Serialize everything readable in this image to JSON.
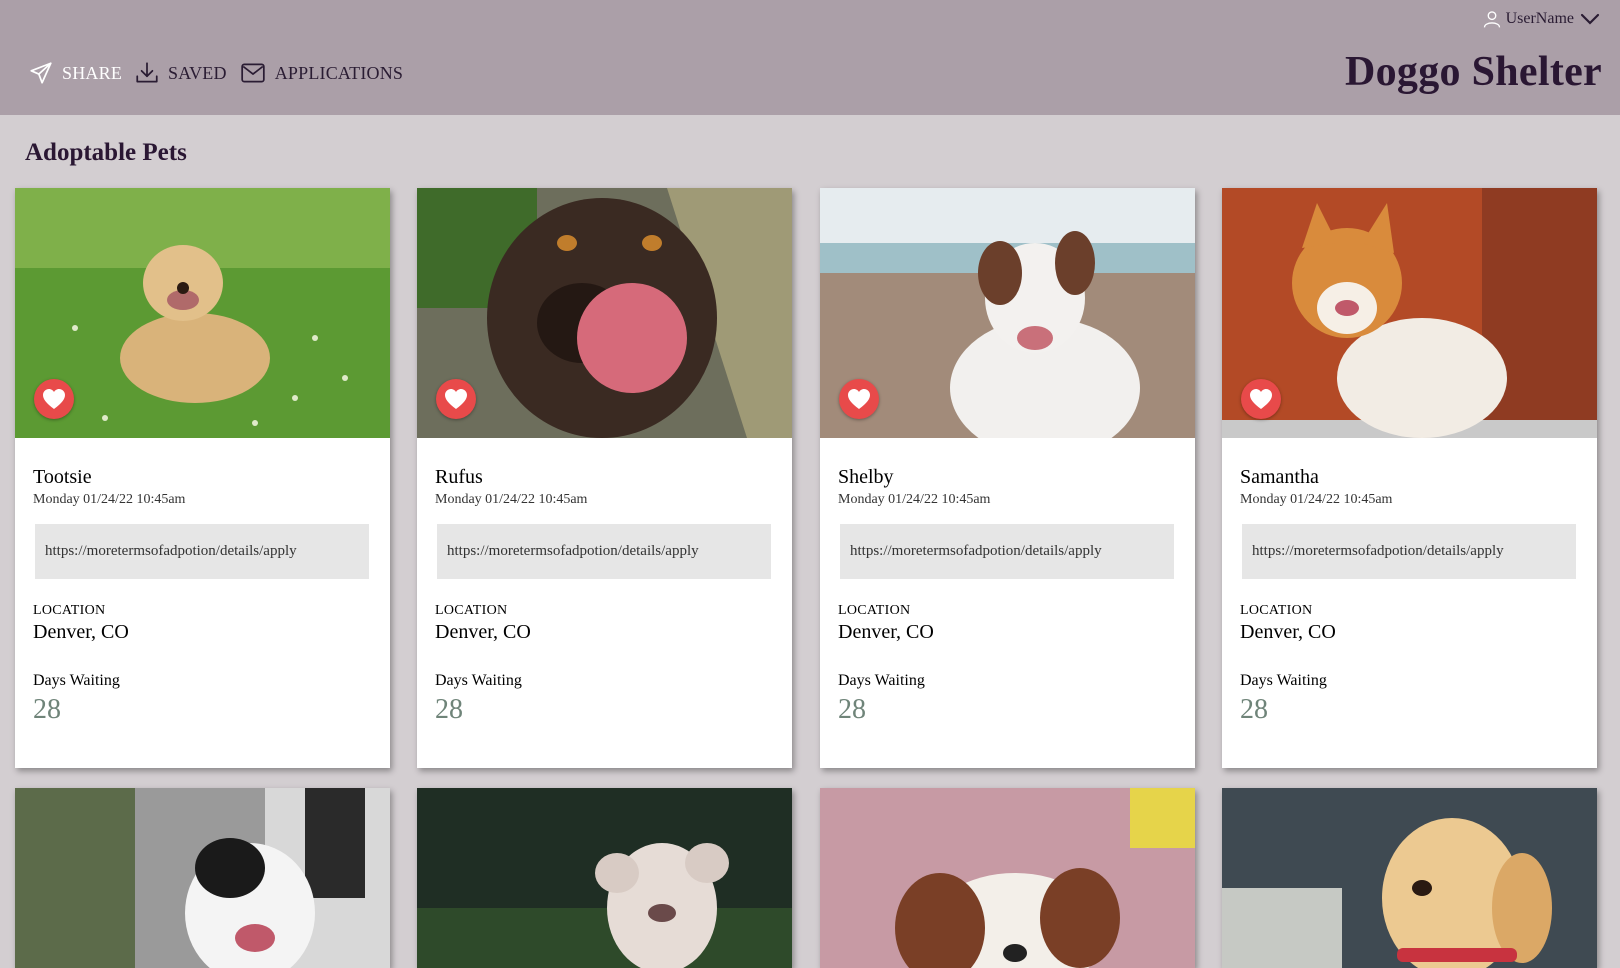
{
  "header": {
    "nav": [
      {
        "label": "SHARE",
        "icon": "send-icon"
      },
      {
        "label": "SAVED",
        "icon": "download-icon"
      },
      {
        "label": "APPLICATIONS",
        "icon": "mail-icon"
      }
    ],
    "user_label": "UserName",
    "brand": "Doggo Shelter"
  },
  "main": {
    "title": "Adoptable Pets",
    "cards": [
      {
        "name": "Tootsie",
        "date": "Monday 01/24/22 10:45am",
        "link": "https://moretermsofadpotion/details/apply",
        "location_label": "LOCATION",
        "location": "Denver, CO",
        "days_label": "Days Waiting",
        "days": "28"
      },
      {
        "name": "Rufus",
        "date": "Monday 01/24/22 10:45am",
        "link": "https://moretermsofadpotion/details/apply",
        "location_label": "LOCATION",
        "location": "Denver, CO",
        "days_label": "Days Waiting",
        "days": "28"
      },
      {
        "name": "Shelby",
        "date": "Monday 01/24/22 10:45am",
        "link": "https://moretermsofadpotion/details/apply",
        "location_label": "LOCATION",
        "location": "Denver, CO",
        "days_label": "Days Waiting",
        "days": "28"
      },
      {
        "name": "Samantha",
        "date": "Monday 01/24/22 10:45am",
        "link": "https://moretermsofadpotion/details/apply",
        "location_label": "LOCATION",
        "location": "Denver, CO",
        "days_label": "Days Waiting",
        "days": "28"
      }
    ]
  },
  "colors": {
    "header_bg": "#ab9fa8",
    "page_bg": "#d3ced1",
    "brand_text": "#2a1733",
    "favorite": "#e84a4a",
    "days_value": "#6f8479"
  }
}
